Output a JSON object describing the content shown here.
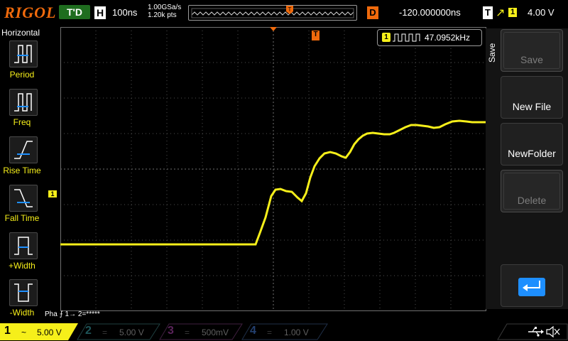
{
  "top": {
    "logo": "RIGOL",
    "run_status": "T'D",
    "horizontal_label": "H",
    "timebase": "100ns",
    "sample_rate": "1.00GSa/s",
    "points": "1.20k pts",
    "delay_label": "D",
    "delay": "-120.000000ns",
    "trigger_label": "T",
    "trigger_edge": "↗",
    "trigger_source": "1",
    "trigger_level": "4.00 V"
  },
  "left_menu": {
    "title": "Horizontal",
    "items": [
      "Period",
      "Freq",
      "Rise Time",
      "Fall Time",
      "+Width",
      "-Width"
    ]
  },
  "waveform": {
    "frequency_badge": "1",
    "frequency": "47.0952kHz",
    "ch1_marker": "1",
    "trigger_marker": "T"
  },
  "right_menu": {
    "title": "Save",
    "buttons": [
      "Save",
      "New File",
      "NewFolder",
      "Delete"
    ]
  },
  "phase_text": "Pha ⨍ 1→ 2=*****",
  "channels": [
    {
      "num": "1",
      "coupling": "~",
      "scale": "5.00 V",
      "color": "#f6ef1a"
    },
    {
      "num": "2",
      "coupling": "=",
      "scale": "5.00 V",
      "color": "#1aa9b3"
    },
    {
      "num": "3",
      "coupling": "=",
      "scale": "500mV",
      "color": "#d62fd6"
    },
    {
      "num": "4",
      "coupling": "=",
      "scale": "1.00 V",
      "color": "#2f7ed6"
    }
  ],
  "colors": {
    "accent": "#f06a0c",
    "ch1": "#f6ef1a",
    "run": "#1f6d1f"
  }
}
